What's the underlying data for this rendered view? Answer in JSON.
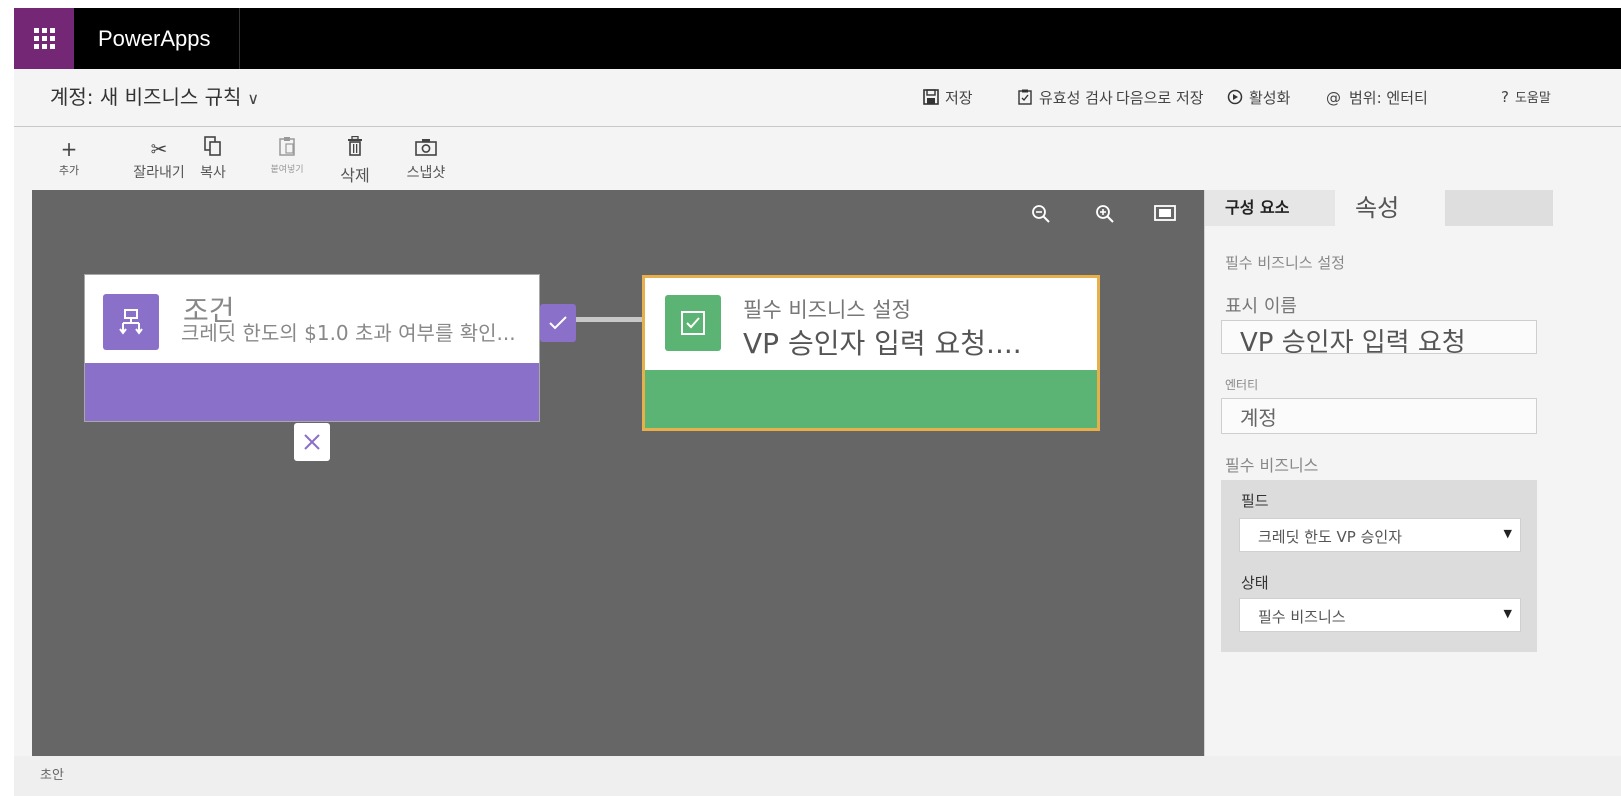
{
  "app": {
    "name": "PowerApps",
    "accent_color": "#742774"
  },
  "header": {
    "title": "계정: 새 비즈니스 규칙",
    "title_chevron": "∨",
    "commands": {
      "save": "저장",
      "validate": "유효성 검사",
      "save_as": "다음으로 저장",
      "activate": "활성화",
      "scope": "범위: 엔터티",
      "help": "도움말"
    }
  },
  "toolbar": {
    "add": "추가",
    "cut": "잘라내기",
    "copy": "복사",
    "paste": "붙여넣기",
    "delete": "삭제",
    "snapshot": "스냅샷"
  },
  "canvas": {
    "condition": {
      "kind": "조건",
      "description": "크레딧 한도의 $1.0 초과 여부를 확인...",
      "color": "#8a70c8"
    },
    "action": {
      "kind": "필수 비즈니스 설정",
      "description": "VP 승인자 입력 요청....",
      "color": "#5bb473",
      "selected_border_color": "#e8b04b"
    },
    "zoom_icons": [
      "zoom-out-icon",
      "zoom-in-icon",
      "fit-to-screen-icon"
    ]
  },
  "panel": {
    "tabs": [
      "구성 요소",
      "속성"
    ],
    "section_title": "필수 비즈니스 설정",
    "display_name_label": "표시 이름",
    "display_name_value": "VP 승인자 입력 요청",
    "entity_label": "엔터티",
    "entity_value": "계정",
    "required_label": "필수 비즈니스",
    "field_label": "필드",
    "field_value": "크레딧 한도 VP 승인자",
    "status_label": "상태",
    "status_value": "필수 비즈니스"
  },
  "status": {
    "text": "초안"
  }
}
